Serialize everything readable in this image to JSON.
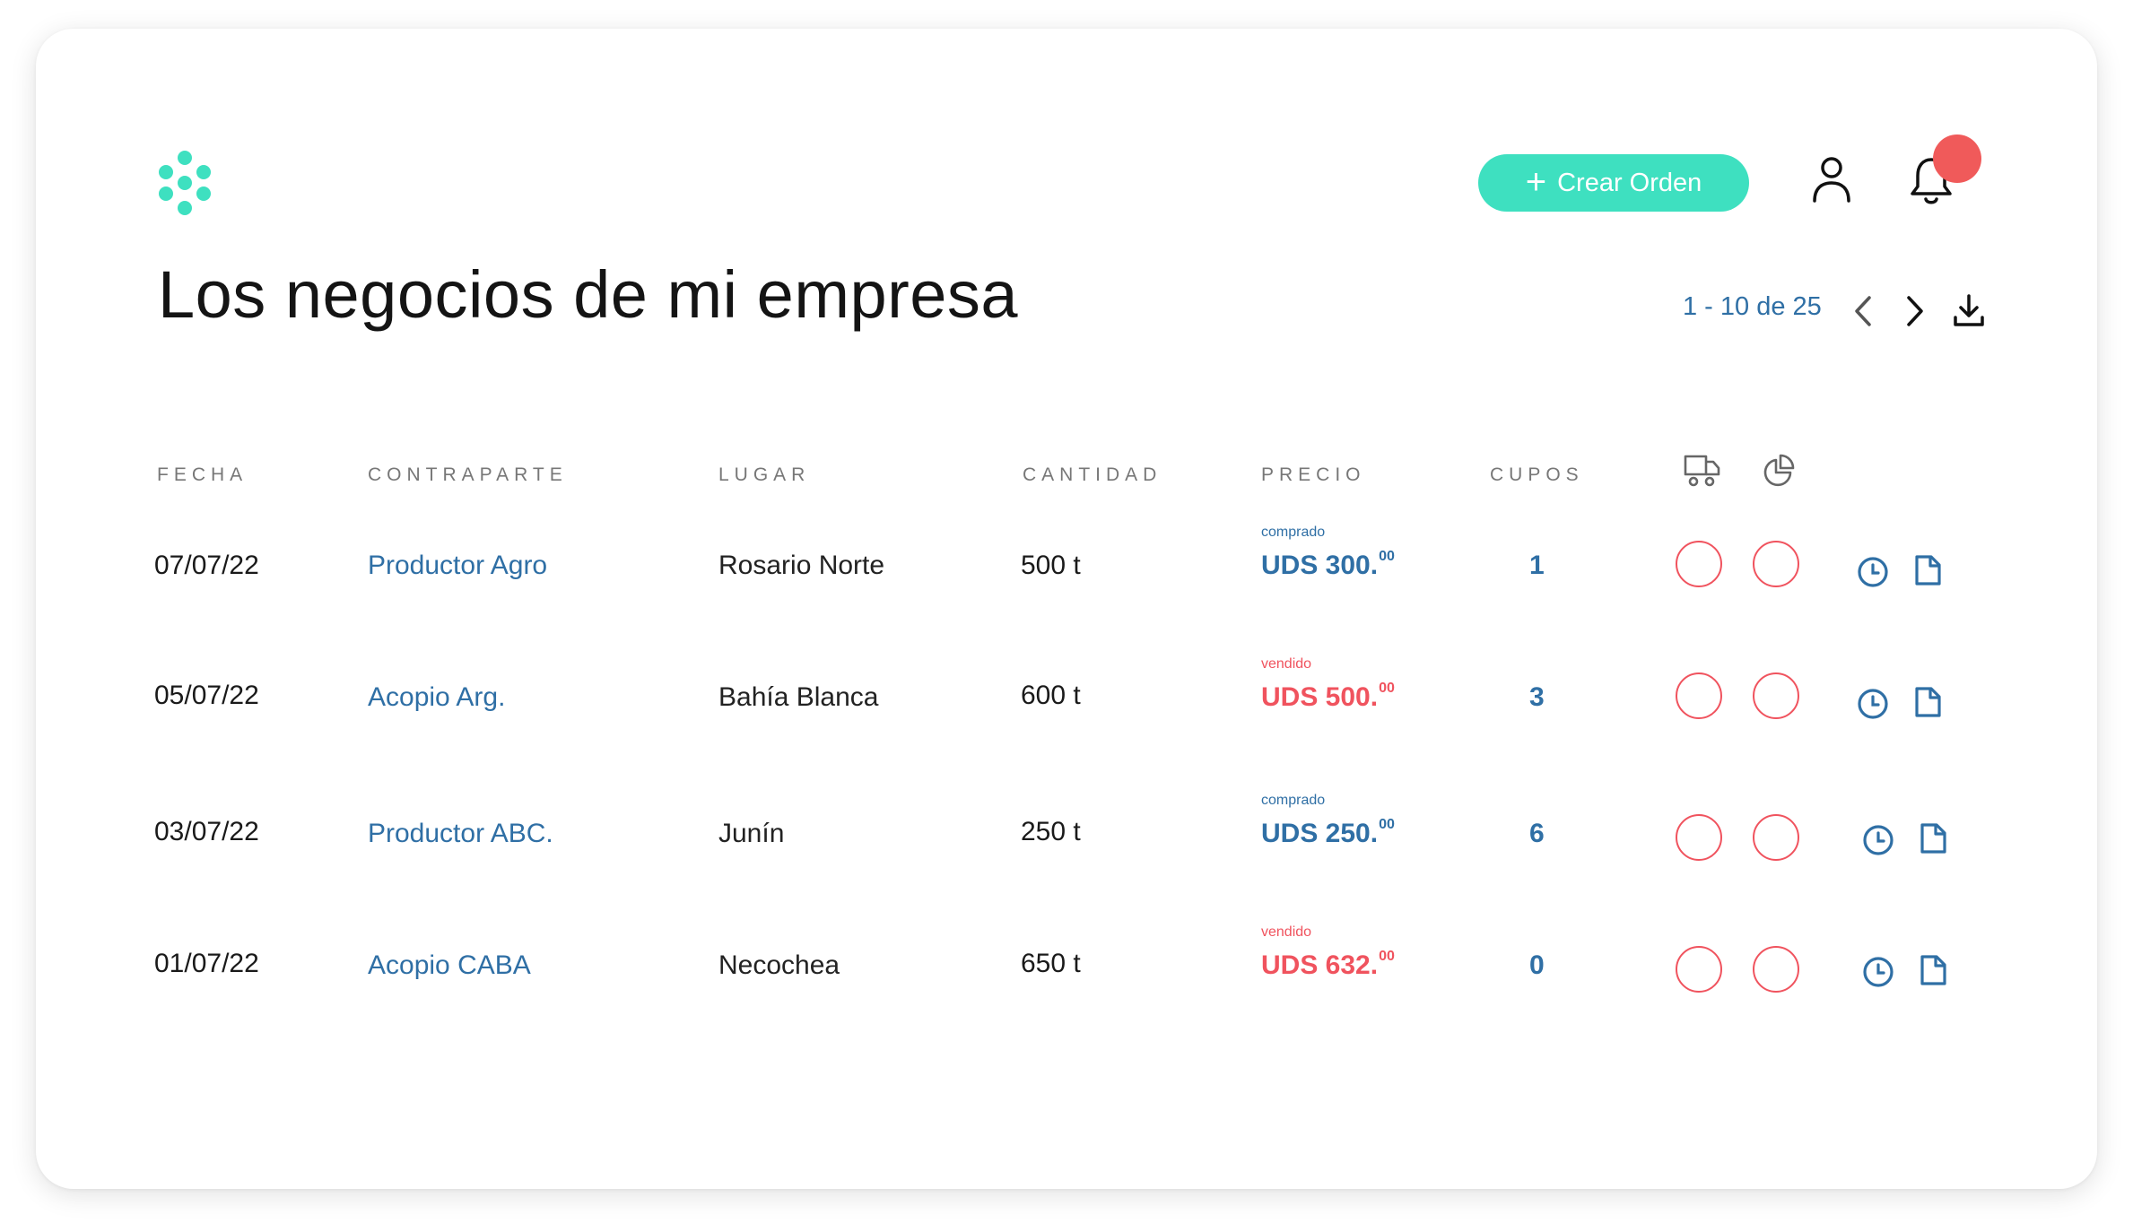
{
  "header": {
    "create_order_label": "Crear Orden",
    "logo_icon": "dots-logo",
    "user_icon": "user-icon",
    "bell_icon": "bell-icon"
  },
  "title": "Los negocios de mi empresa",
  "pagination": {
    "label": "1 - 10 de 25"
  },
  "table": {
    "columns": [
      "FECHA",
      "CONTRAPARTE",
      "LUGAR",
      "CANTIDAD",
      "PRECIO",
      "CUPOS"
    ],
    "icon_columns": [
      "truck-icon",
      "pie-chart-icon"
    ],
    "rows": [
      {
        "date": "07/07/22",
        "party": "Productor Agro",
        "place": "Rosario Norte",
        "qty": "500 t",
        "note": "comprado",
        "price": "UDS 300.",
        "cents": "00",
        "cupos": "1"
      },
      {
        "date": "05/07/22",
        "party": "Acopio Arg.",
        "place": "Bahía Blanca",
        "qty": "600 t",
        "note": "vendido",
        "price": "UDS 500.",
        "cents": "00",
        "cupos": "3"
      },
      {
        "date": "03/07/22",
        "party": "Productor ABC.",
        "place": "Junín",
        "qty": "250 t",
        "note": "comprado",
        "price": "UDS 250.",
        "cents": "00",
        "cupos": "6"
      },
      {
        "date": "01/07/22",
        "party": "Acopio CABA",
        "place": "Necochea",
        "qty": "650 t",
        "note": "vendido",
        "price": "UDS 632.",
        "cents": "00",
        "cupos": "0"
      }
    ]
  },
  "colors": {
    "accent": "#3ee0c0",
    "link_blue": "#2f6fa5",
    "alert_red": "#f0535e",
    "notification": "#f05a5a"
  }
}
